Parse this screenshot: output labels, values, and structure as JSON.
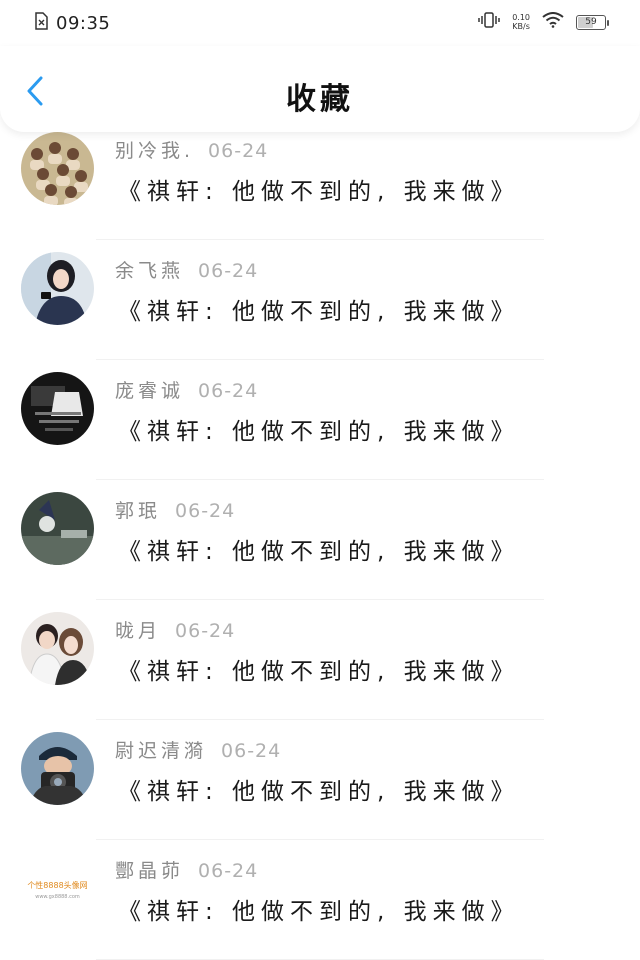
{
  "status_bar": {
    "time": "09:35",
    "net_speed": "0.10",
    "net_unit": "KB/s",
    "battery_level": "59"
  },
  "header": {
    "title": "收藏"
  },
  "items": [
    {
      "name": "别冷我.",
      "date": "06-24",
      "title": "《祺轩: 他做不到的, 我来做》",
      "avatar": "group-photo"
    },
    {
      "name": "余飞燕",
      "date": "06-24",
      "title": "《祺轩: 他做不到的, 我来做》",
      "avatar": "girl-with-phone"
    },
    {
      "name": "庞睿诚",
      "date": "06-24",
      "title": "《祺轩: 他做不到的, 我来做》",
      "avatar": "dark-text"
    },
    {
      "name": "郭珉",
      "date": "06-24",
      "title": "《祺轩: 他做不到的, 我来做》",
      "avatar": "hooded-figure"
    },
    {
      "name": "昽月",
      "date": "06-24",
      "title": "《祺轩: 他做不到的, 我来做》",
      "avatar": "couple"
    },
    {
      "name": "尉迟清漪",
      "date": "06-24",
      "title": "《祺轩: 他做不到的, 我来做》",
      "avatar": "camera-guy"
    },
    {
      "name": "酆晶茆",
      "date": "06-24",
      "title": "《祺轩: 他做不到的, 我来做》",
      "avatar": "logo-text",
      "avatar_text": "个性8888头像网",
      "avatar_subtext": "www.gx8888.com"
    }
  ]
}
